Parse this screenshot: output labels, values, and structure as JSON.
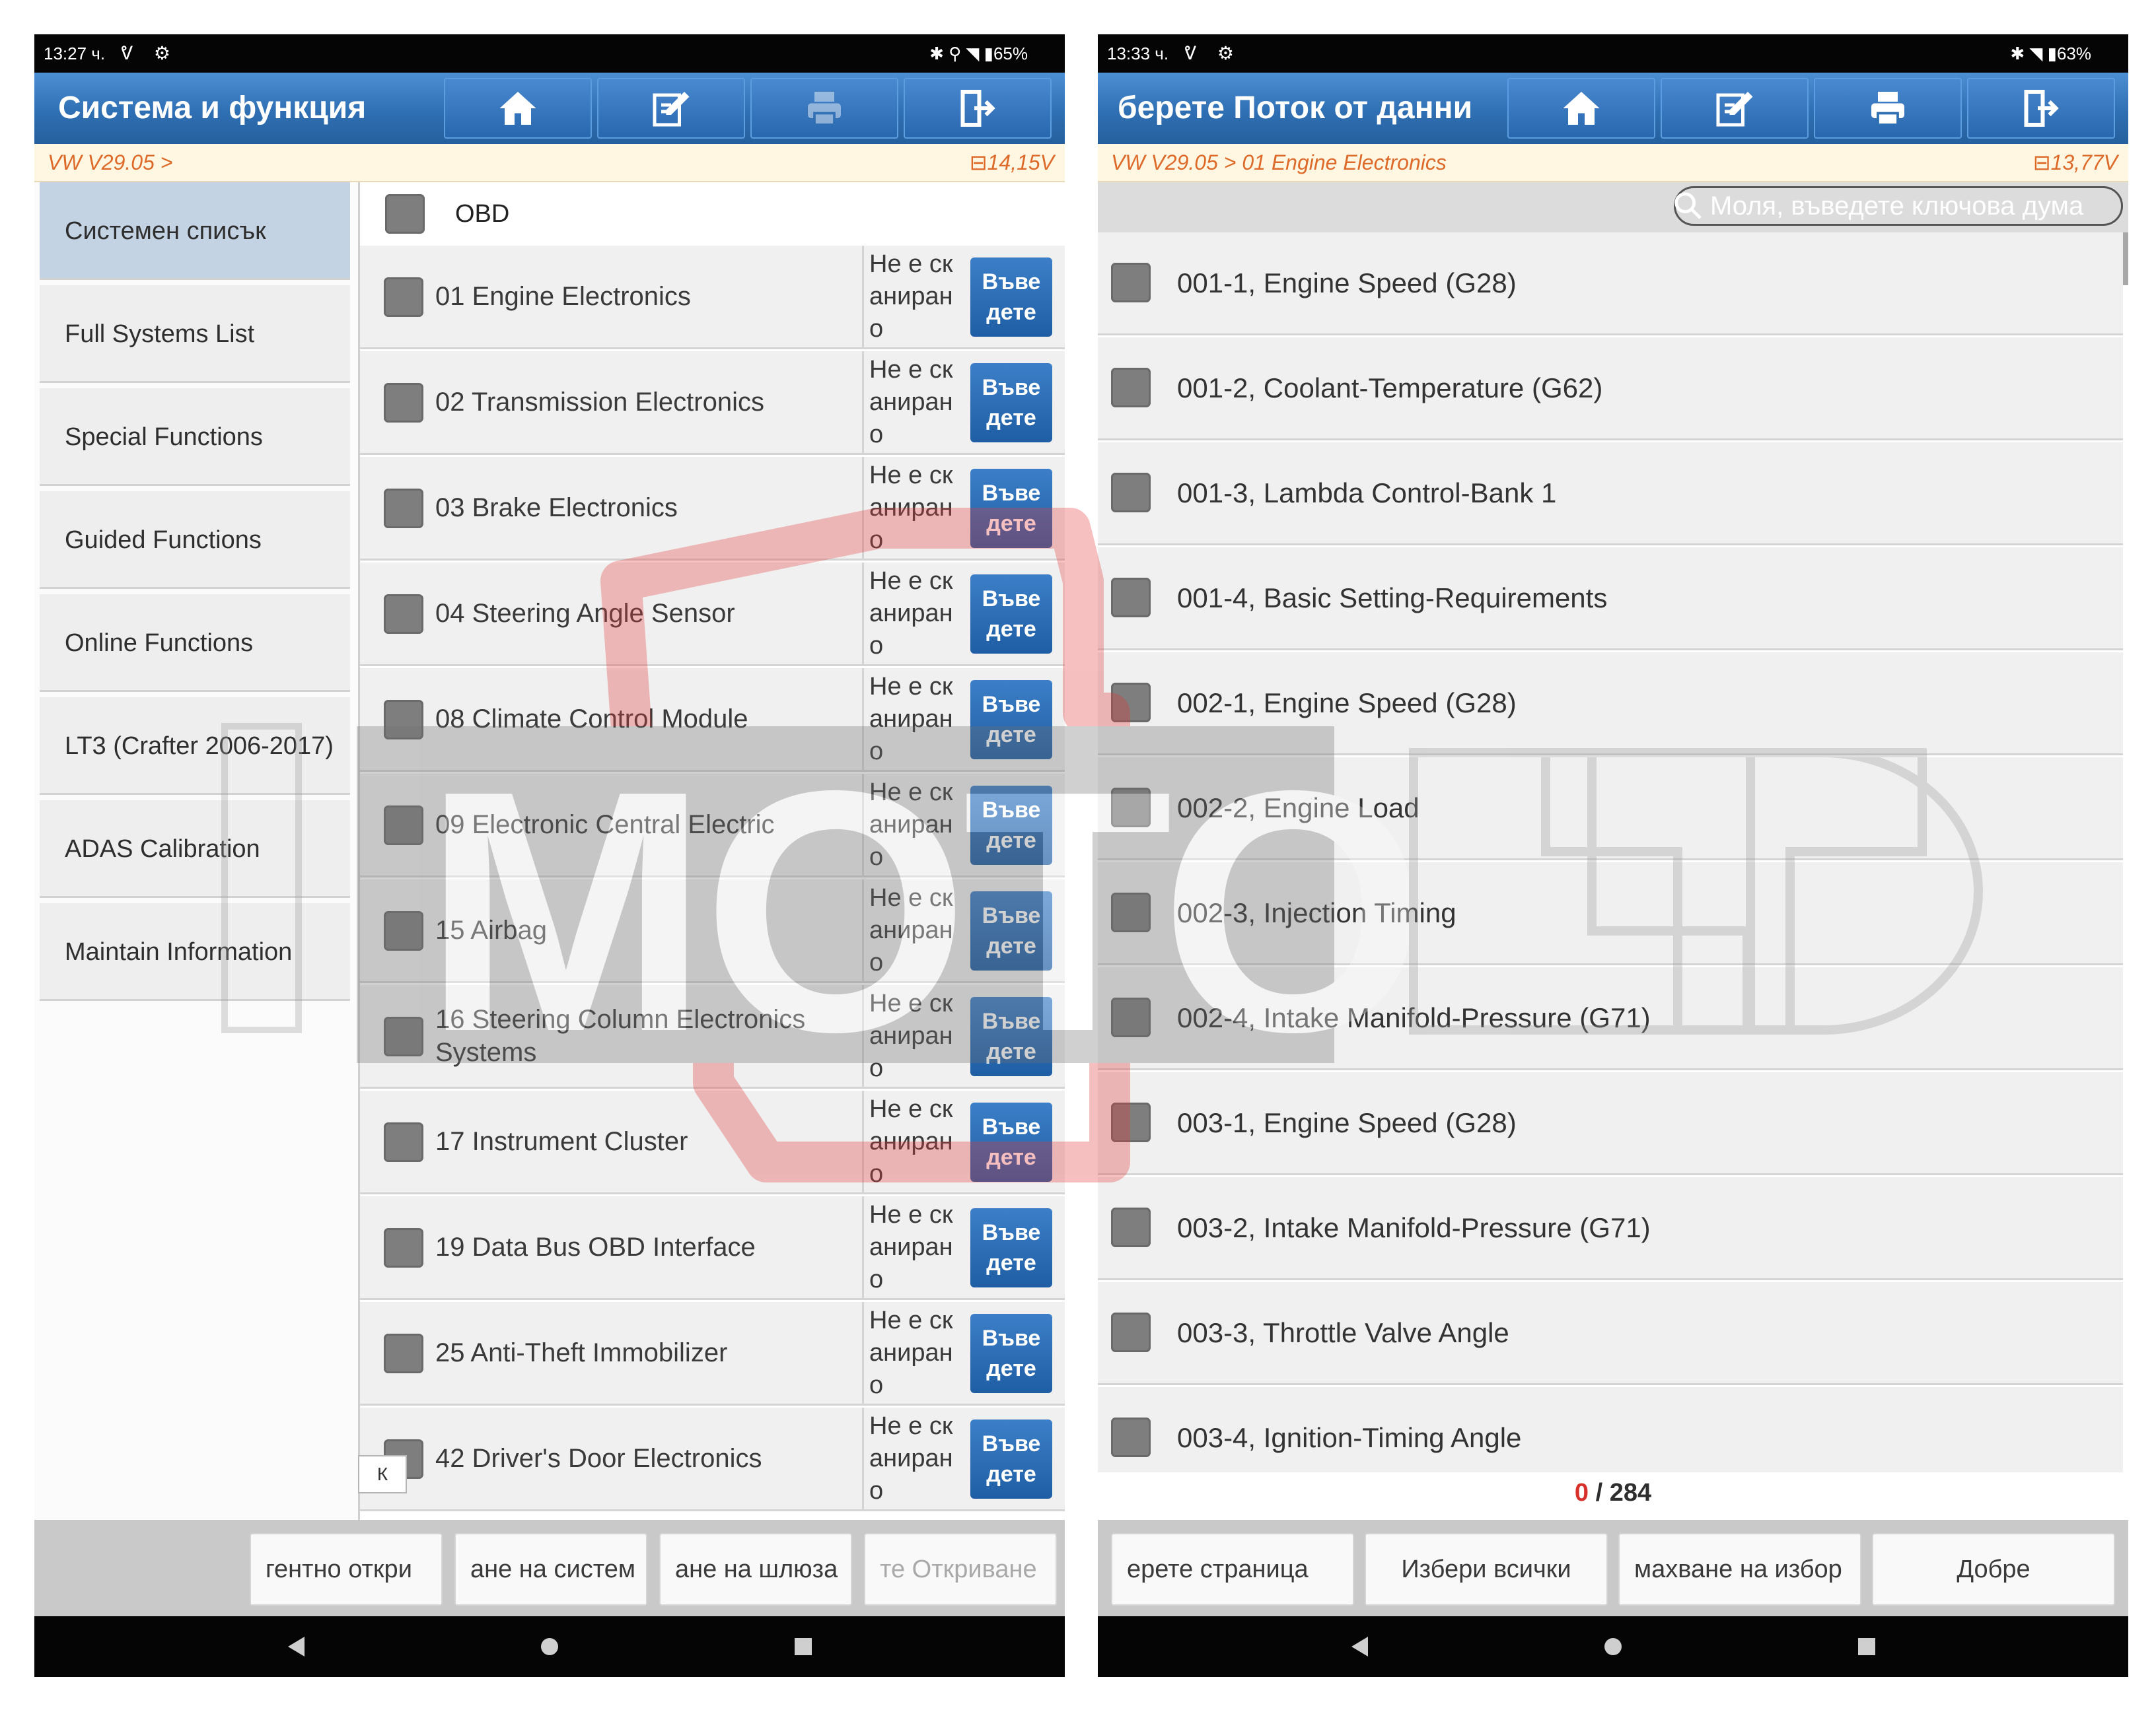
{
  "left": {
    "status": {
      "time": "13:27 ч.",
      "icons": "ᕓ ⚙",
      "right": "✱ ⚲ ◥ ▮65%"
    },
    "title": "Система и функция",
    "toolbar": [
      "home-icon",
      "edit-icon",
      "print-icon",
      "exit-icon"
    ],
    "breadcrumb": "VW V29.05 >",
    "voltage": "14,15V",
    "sidebar": [
      {
        "label": "Системен списък",
        "active": true
      },
      {
        "label": "Full Systems List"
      },
      {
        "label": "Special Functions"
      },
      {
        "label": "Guided Functions"
      },
      {
        "label": "Online Functions"
      },
      {
        "label": "LT3 (Crafter 2006-2017)"
      },
      {
        "label": "ADAS Calibration"
      },
      {
        "label": "Maintain Information"
      }
    ],
    "obd_label": "OBD",
    "systems": [
      {
        "name": "01 Engine Electronics",
        "status": "Не е сканирано",
        "button": "Въведете"
      },
      {
        "name": "02 Transmission Electronics",
        "status": "Не е сканирано",
        "button": "Въведете"
      },
      {
        "name": "03 Brake Electronics",
        "status": "Не е сканирано",
        "button": "Въведете"
      },
      {
        "name": "04 Steering Angle Sensor",
        "status": "Не е сканирано",
        "button": "Въведете"
      },
      {
        "name": "08 Climate Control Module",
        "status": "Не е сканирано",
        "button": "Въведете"
      },
      {
        "name": "09 Electronic Central Electric",
        "status": "Не е сканирано",
        "button": "Въведете"
      },
      {
        "name": "15 Airbag",
        "status": "Не е сканирано",
        "button": "Въведете"
      },
      {
        "name": "16 Steering Column Electronics Systems",
        "status": "Не е сканирано",
        "button": "Въведете"
      },
      {
        "name": "17 Instrument Cluster",
        "status": "Не е сканирано",
        "button": "Въведете"
      },
      {
        "name": "19 Data Bus OBD Interface",
        "status": "Не е сканирано",
        "button": "Въведете"
      },
      {
        "name": "25 Anti-Theft Immobilizer",
        "status": "Не е сканирано",
        "button": "Въведете"
      },
      {
        "name": "42 Driver's Door Electronics",
        "status": "Не е сканирано",
        "button": "Въведете"
      }
    ],
    "collapse_label": "К",
    "bottom_buttons": [
      {
        "label": "гентно откри"
      },
      {
        "label": "ане на систем"
      },
      {
        "label": "ане на шлюза"
      },
      {
        "label": "те Откриване",
        "disabled": true
      }
    ]
  },
  "right": {
    "status": {
      "time": "13:33 ч.",
      "icons": "ᕓ ⚙",
      "right": "✱ ◥ ▮63%"
    },
    "title": "берете Поток от данни",
    "toolbar": [
      "home-icon",
      "edit-icon",
      "print-icon",
      "exit-icon"
    ],
    "breadcrumb": "VW V29.05 > 01 Engine Electronics",
    "voltage": "13,77V",
    "search_placeholder": "Моля, въведете ключова дума",
    "pids": [
      "001-1, Engine Speed (G28)",
      "001-2, Coolant-Temperature (G62)",
      "001-3, Lambda Control-Bank 1",
      "001-4, Basic Setting-Requirements",
      "002-1, Engine Speed (G28)",
      "002-2, Engine Load",
      "002-3, Injection Timing",
      "002-4, Intake Manifold-Pressure (G71)",
      "003-1, Engine Speed (G28)",
      "003-2, Intake Manifold-Pressure (G71)",
      "003-3, Throttle Valve Angle",
      "003-4, Ignition-Timing Angle"
    ],
    "selected_count": "0",
    "total_count": "/ 284",
    "bottom_buttons": [
      {
        "label": "ерете страница"
      },
      {
        "label": "Избери всички"
      },
      {
        "label": "махване на избор"
      },
      {
        "label": "Добре"
      }
    ]
  },
  "watermark": {
    "text": "MOTO LTD",
    "colors": {
      "red": "#e23a3a",
      "grey": "#9a9a9a"
    }
  },
  "colors": {
    "title_bar": "#2f6fb3",
    "accent_orange": "#de6a2a",
    "enter_button": "#1f5ea4",
    "selected_red": "#d8302a"
  }
}
